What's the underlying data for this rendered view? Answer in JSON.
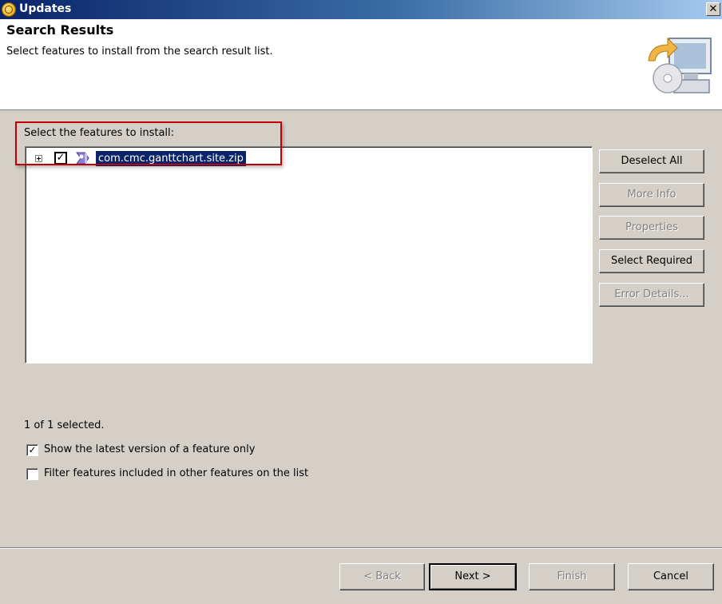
{
  "window": {
    "title": "Updates",
    "close_glyph": "✕"
  },
  "header": {
    "title": "Search Results",
    "description": "Select features to install from the search result list.",
    "image_icon": "update-wizard-icon"
  },
  "features": {
    "group_label": "Select the features to install:",
    "items": [
      {
        "label": "com.cmc.ganttchart.site.zip",
        "checked": true,
        "icon": "site-feature-icon",
        "expander_icon": "expand-plus-icon"
      }
    ],
    "check_glyph": "✓"
  },
  "buttons": {
    "deselect_all": "Deselect All",
    "more_info": "More Info",
    "properties": "Properties",
    "select_required": "Select Required",
    "error_details": "Error Details..."
  },
  "status": "1 of 1 selected.",
  "options": {
    "latest_version": {
      "label": "Show the latest version of a feature only",
      "checked": true
    },
    "filter_included": {
      "label": "Filter features included in other features on the list",
      "checked": false
    }
  },
  "nav": {
    "back": "< Back",
    "next": "Next >",
    "finish": "Finish",
    "cancel": "Cancel"
  },
  "colors": {
    "title_bar": "#0a246a",
    "selection": "#0a246a",
    "highlight_border": "#c00000",
    "face": "#d4d0c8"
  }
}
